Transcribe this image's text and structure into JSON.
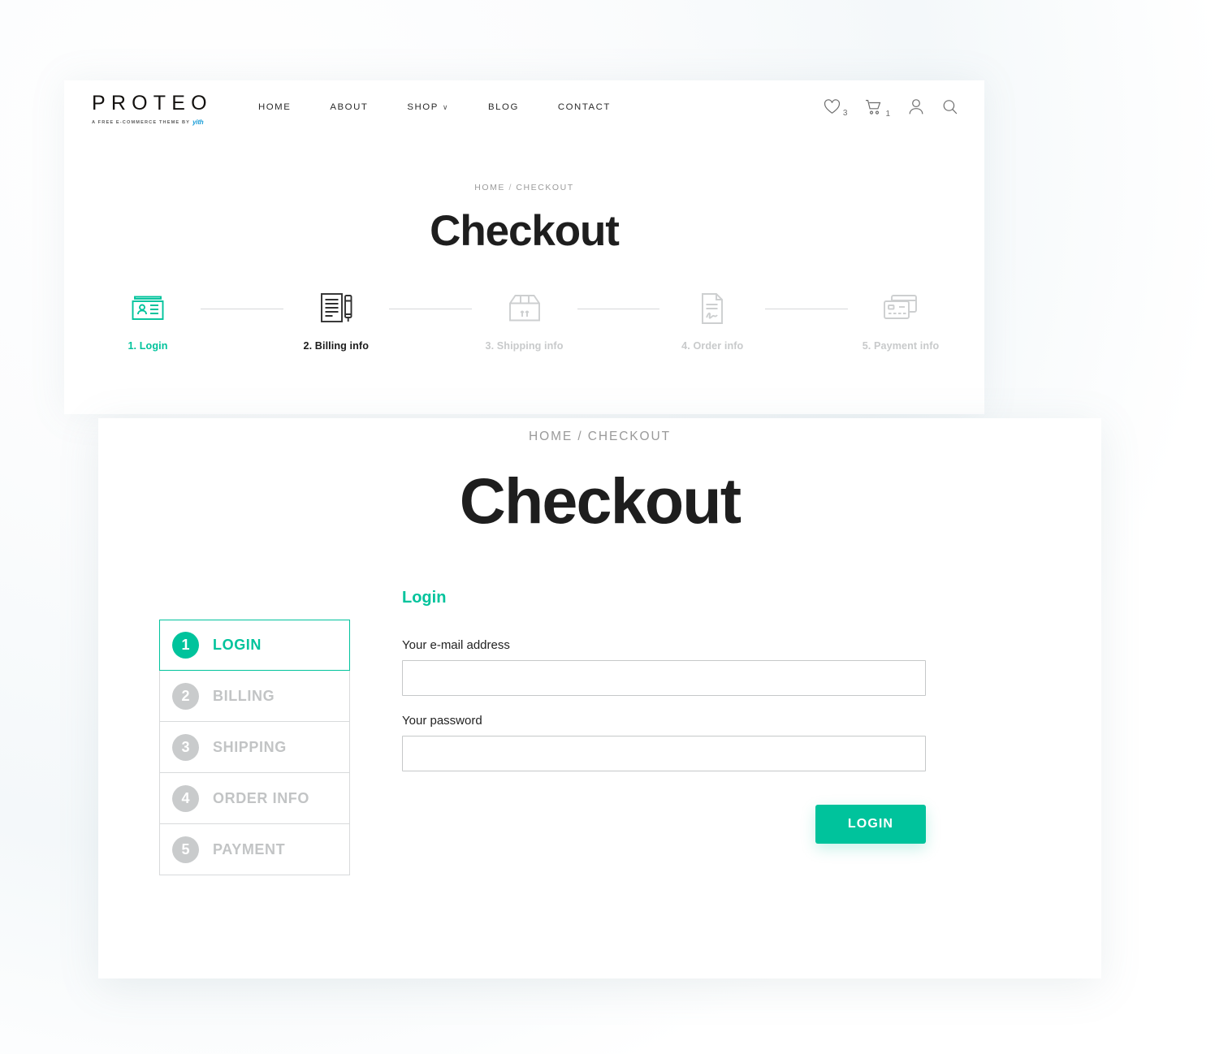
{
  "brand": {
    "name": "PROTEO",
    "tagline": "A FREE E-COMMERCE THEME BY",
    "tagline_brand": "yith"
  },
  "nav": {
    "items": [
      {
        "label": "HOME",
        "has_caret": false
      },
      {
        "label": "ABOUT",
        "has_caret": false
      },
      {
        "label": "SHOP",
        "has_caret": true,
        "caret": "∨"
      },
      {
        "label": "BLOG",
        "has_caret": false
      },
      {
        "label": "CONTACT",
        "has_caret": false
      }
    ]
  },
  "header_icons": {
    "wishlist": {
      "icon": "heart-icon",
      "count": "3"
    },
    "cart": {
      "icon": "cart-icon",
      "count": "1"
    },
    "account": {
      "icon": "user-icon"
    },
    "search": {
      "icon": "search-icon"
    }
  },
  "hero": {
    "breadcrumb_home": "HOME",
    "breadcrumb_sep": "/",
    "breadcrumb_current": "CHECKOUT",
    "title": "Checkout"
  },
  "progress_steps": [
    {
      "label": "1. Login",
      "icon": "id-card-icon",
      "state": "active"
    },
    {
      "label": "2. Billing info",
      "icon": "document-pen-icon",
      "state": "current"
    },
    {
      "label": "3. Shipping info",
      "icon": "shipping-box-icon",
      "state": "muted"
    },
    {
      "label": "4. Order info",
      "icon": "signed-document-icon",
      "state": "muted"
    },
    {
      "label": "5. Payment info",
      "icon": "credit-cards-icon",
      "state": "muted"
    }
  ],
  "page": {
    "breadcrumb_home": "HOME",
    "breadcrumb_sep": "/",
    "breadcrumb_current": "CHECKOUT",
    "title": "Checkout"
  },
  "step_nav": [
    {
      "number": "1",
      "label": "LOGIN",
      "active": true
    },
    {
      "number": "2",
      "label": "BILLING",
      "active": false
    },
    {
      "number": "3",
      "label": "SHIPPING",
      "active": false
    },
    {
      "number": "4",
      "label": "ORDER INFO",
      "active": false
    },
    {
      "number": "5",
      "label": "PAYMENT",
      "active": false
    }
  ],
  "login_form": {
    "heading": "Login",
    "email_label": "Your e-mail address",
    "email_value": "",
    "email_placeholder": "",
    "password_label": "Your password",
    "password_value": "",
    "password_placeholder": "",
    "submit_label": "LOGIN"
  },
  "colors": {
    "accent": "#00c39c",
    "text_dark": "#1e1e1e",
    "text_muted": "#c2c4c5",
    "brand_blue": "#1d9fd8"
  }
}
